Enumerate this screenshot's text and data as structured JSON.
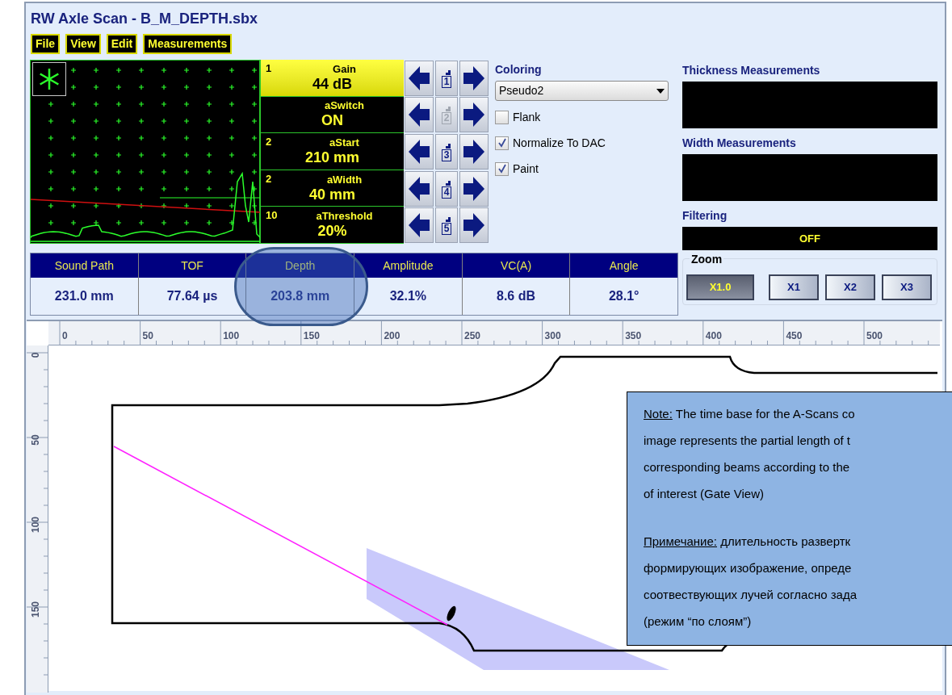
{
  "window": {
    "title": "RW Axle Scan - B_M_DEPTH.sbx"
  },
  "menu": [
    "File",
    "View",
    "Edit",
    "Measurements"
  ],
  "parameters": [
    {
      "channel": "1",
      "label": "Gain",
      "value": "44 dB",
      "selected": true,
      "step": "1",
      "step_disabled": false
    },
    {
      "label": "aSwitch",
      "value": "ON",
      "selected": false,
      "step": "2",
      "step_disabled": true
    },
    {
      "channel": "2",
      "label": "aStart",
      "value": "210 mm",
      "selected": false,
      "step": "3",
      "step_disabled": false
    },
    {
      "channel": "2",
      "label": "aWidth",
      "value": "40 mm",
      "selected": false,
      "step": "4",
      "step_disabled": false
    },
    {
      "channel": "10",
      "label": "aThreshold",
      "value": "20%",
      "selected": false,
      "step": "5",
      "step_disabled": false
    }
  ],
  "coloring": {
    "label": "Coloring",
    "value": "Pseudo2",
    "options": [
      {
        "label": "Flank",
        "checked": false
      },
      {
        "label": "Normalize To DAC",
        "checked": true
      },
      {
        "label": "Paint",
        "checked": true
      }
    ]
  },
  "thickness": {
    "label": "Thickness Measurements"
  },
  "width": {
    "label": "Width Measurements"
  },
  "filtering": {
    "label": "Filtering",
    "value": "OFF"
  },
  "zoom": {
    "label": "Zoom",
    "buttons": [
      {
        "label": "X1.0",
        "selected": true
      },
      {
        "label": "X1",
        "selected": false
      },
      {
        "label": "X2",
        "selected": false
      },
      {
        "label": "X3",
        "selected": false
      }
    ]
  },
  "measurements": [
    {
      "label": "Sound Path",
      "value": "231.0 mm"
    },
    {
      "label": "TOF",
      "value": "77.64 µs"
    },
    {
      "label": "Depth",
      "value": "203.8 mm"
    },
    {
      "label": "Amplitude",
      "value": "32.1%"
    },
    {
      "label": "VC(A)",
      "value": "8.6 dB"
    },
    {
      "label": "Angle",
      "value": "28.1°"
    }
  ],
  "ruler": {
    "x_labels": [
      "0",
      "50",
      "100",
      "150",
      "200",
      "250",
      "300",
      "350",
      "400",
      "450",
      "500"
    ],
    "y_labels": [
      "0",
      "50",
      "100",
      "150"
    ]
  },
  "notes": [
    {
      "label": "Note:",
      "lines": [
        "The time base for the A-Scans co",
        "image represents the partial length of t",
        "corresponding beams according to the",
        "of interest (Gate View)"
      ]
    },
    {
      "label": "Примечание:",
      "lines": [
        "длительность развертк",
        "формирующих изображение, опреде",
        "соотвествующих лучей согласно зада",
        "(режим “по слоям”)"
      ]
    }
  ]
}
